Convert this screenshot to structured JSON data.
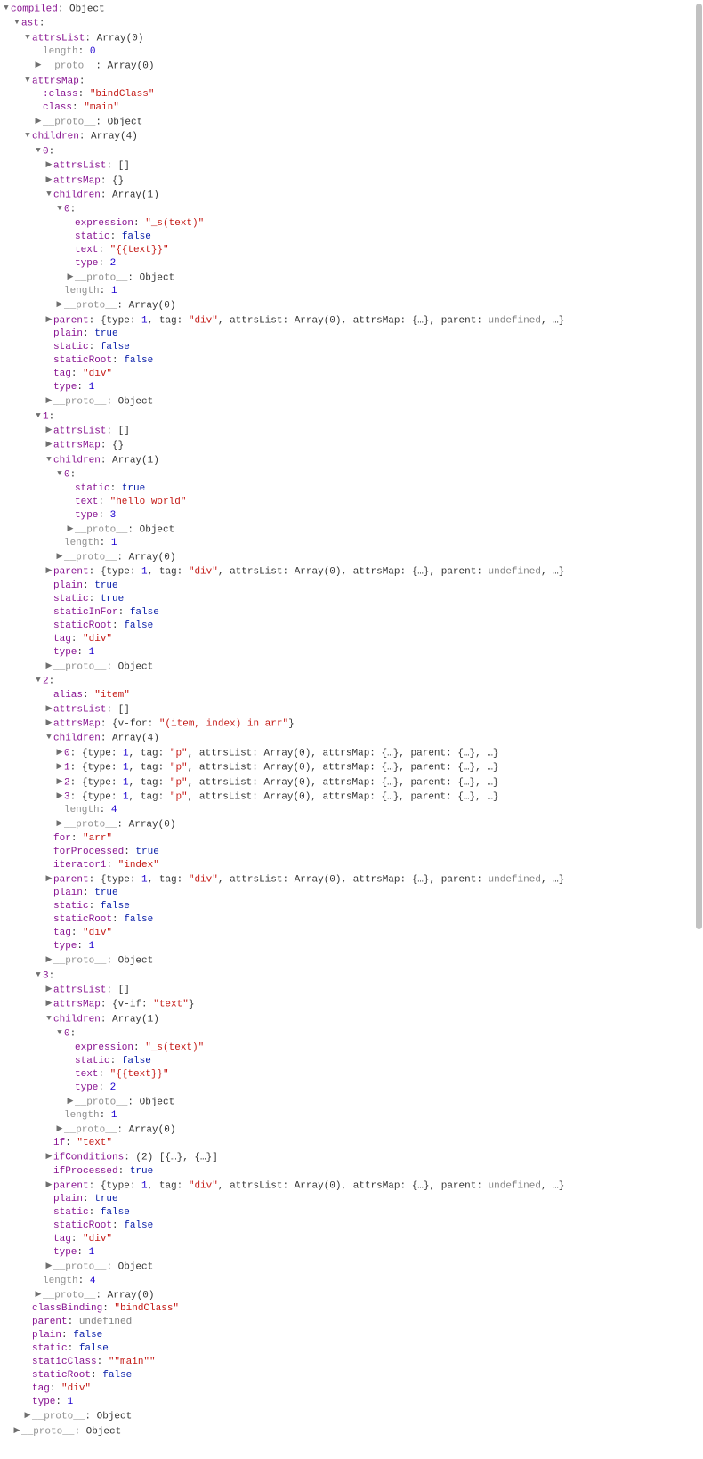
{
  "lines": [
    {
      "indent": 0,
      "arrow": "down",
      "key": "compiled",
      "cls": "key",
      "sep": ": ",
      "val": "Object",
      "vcls": "obj"
    },
    {
      "indent": 1,
      "arrow": "down",
      "key": "ast",
      "cls": "key",
      "sep": ":",
      "val": "",
      "vcls": ""
    },
    {
      "indent": 2,
      "arrow": "down",
      "key": "attrsList",
      "cls": "key",
      "sep": ": ",
      "val": "Array(0)",
      "vcls": "obj"
    },
    {
      "indent": 3,
      "arrow": "none",
      "key": "length",
      "cls": "faded",
      "sep": ": ",
      "val": "0",
      "vcls": "num"
    },
    {
      "indent": 3,
      "arrow": "right",
      "key": "__proto__",
      "cls": "faded",
      "sep": ": ",
      "val": "Array(0)",
      "vcls": "obj"
    },
    {
      "indent": 2,
      "arrow": "down",
      "key": "attrsMap",
      "cls": "key",
      "sep": ":",
      "val": "",
      "vcls": ""
    },
    {
      "indent": 3,
      "arrow": "none",
      "key": ":class",
      "cls": "key",
      "sep": ": ",
      "val": "\"bindClass\"",
      "vcls": "str"
    },
    {
      "indent": 3,
      "arrow": "none",
      "key": "class",
      "cls": "key",
      "sep": ": ",
      "val": "\"main\"",
      "vcls": "str"
    },
    {
      "indent": 3,
      "arrow": "right",
      "key": "__proto__",
      "cls": "faded",
      "sep": ": ",
      "val": "Object",
      "vcls": "obj"
    },
    {
      "indent": 2,
      "arrow": "down",
      "key": "children",
      "cls": "key",
      "sep": ": ",
      "val": "Array(4)",
      "vcls": "obj"
    },
    {
      "indent": 3,
      "arrow": "down",
      "key": "0",
      "cls": "key",
      "sep": ":",
      "val": "",
      "vcls": ""
    },
    {
      "indent": 4,
      "arrow": "right",
      "key": "attrsList",
      "cls": "key",
      "sep": ": ",
      "val": "[]",
      "vcls": "obj"
    },
    {
      "indent": 4,
      "arrow": "right",
      "key": "attrsMap",
      "cls": "key",
      "sep": ": ",
      "val": "{}",
      "vcls": "obj"
    },
    {
      "indent": 4,
      "arrow": "down",
      "key": "children",
      "cls": "key",
      "sep": ": ",
      "val": "Array(1)",
      "vcls": "obj"
    },
    {
      "indent": 5,
      "arrow": "down",
      "key": "0",
      "cls": "key",
      "sep": ":",
      "val": "",
      "vcls": ""
    },
    {
      "indent": 6,
      "arrow": "none",
      "key": "expression",
      "cls": "key",
      "sep": ": ",
      "val": "\"_s(text)\"",
      "vcls": "str"
    },
    {
      "indent": 6,
      "arrow": "none",
      "key": "static",
      "cls": "key",
      "sep": ": ",
      "val": "false",
      "vcls": "bool"
    },
    {
      "indent": 6,
      "arrow": "none",
      "key": "text",
      "cls": "key",
      "sep": ": ",
      "val": "\"{{text}}\"",
      "vcls": "str"
    },
    {
      "indent": 6,
      "arrow": "none",
      "key": "type",
      "cls": "key",
      "sep": ": ",
      "val": "2",
      "vcls": "num"
    },
    {
      "indent": 6,
      "arrow": "right",
      "key": "__proto__",
      "cls": "faded",
      "sep": ": ",
      "val": "Object",
      "vcls": "obj"
    },
    {
      "indent": 5,
      "arrow": "none",
      "key": "length",
      "cls": "faded",
      "sep": ": ",
      "val": "1",
      "vcls": "num"
    },
    {
      "indent": 5,
      "arrow": "right",
      "key": "__proto__",
      "cls": "faded",
      "sep": ": ",
      "val": "Array(0)",
      "vcls": "obj"
    },
    {
      "indent": 4,
      "arrow": "right",
      "key": "parent",
      "cls": "key",
      "sep": ": ",
      "html": "{type: <span class='num'>1</span>, tag: <span class='str'>\"div\"</span>, attrsList: Array(0), attrsMap: {…}, parent: <span class='undef'>undefined</span>, …}"
    },
    {
      "indent": 4,
      "arrow": "none",
      "key": "plain",
      "cls": "key",
      "sep": ": ",
      "val": "true",
      "vcls": "bool"
    },
    {
      "indent": 4,
      "arrow": "none",
      "key": "static",
      "cls": "key",
      "sep": ": ",
      "val": "false",
      "vcls": "bool"
    },
    {
      "indent": 4,
      "arrow": "none",
      "key": "staticRoot",
      "cls": "key",
      "sep": ": ",
      "val": "false",
      "vcls": "bool"
    },
    {
      "indent": 4,
      "arrow": "none",
      "key": "tag",
      "cls": "key",
      "sep": ": ",
      "val": "\"div\"",
      "vcls": "str"
    },
    {
      "indent": 4,
      "arrow": "none",
      "key": "type",
      "cls": "key",
      "sep": ": ",
      "val": "1",
      "vcls": "num"
    },
    {
      "indent": 4,
      "arrow": "right",
      "key": "__proto__",
      "cls": "faded",
      "sep": ": ",
      "val": "Object",
      "vcls": "obj"
    },
    {
      "indent": 3,
      "arrow": "down",
      "key": "1",
      "cls": "key",
      "sep": ":",
      "val": "",
      "vcls": ""
    },
    {
      "indent": 4,
      "arrow": "right",
      "key": "attrsList",
      "cls": "key",
      "sep": ": ",
      "val": "[]",
      "vcls": "obj"
    },
    {
      "indent": 4,
      "arrow": "right",
      "key": "attrsMap",
      "cls": "key",
      "sep": ": ",
      "val": "{}",
      "vcls": "obj"
    },
    {
      "indent": 4,
      "arrow": "down",
      "key": "children",
      "cls": "key",
      "sep": ": ",
      "val": "Array(1)",
      "vcls": "obj"
    },
    {
      "indent": 5,
      "arrow": "down",
      "key": "0",
      "cls": "key",
      "sep": ":",
      "val": "",
      "vcls": ""
    },
    {
      "indent": 6,
      "arrow": "none",
      "key": "static",
      "cls": "key",
      "sep": ": ",
      "val": "true",
      "vcls": "bool"
    },
    {
      "indent": 6,
      "arrow": "none",
      "key": "text",
      "cls": "key",
      "sep": ": ",
      "val": "\"hello world\"",
      "vcls": "str"
    },
    {
      "indent": 6,
      "arrow": "none",
      "key": "type",
      "cls": "key",
      "sep": ": ",
      "val": "3",
      "vcls": "num"
    },
    {
      "indent": 6,
      "arrow": "right",
      "key": "__proto__",
      "cls": "faded",
      "sep": ": ",
      "val": "Object",
      "vcls": "obj"
    },
    {
      "indent": 5,
      "arrow": "none",
      "key": "length",
      "cls": "faded",
      "sep": ": ",
      "val": "1",
      "vcls": "num"
    },
    {
      "indent": 5,
      "arrow": "right",
      "key": "__proto__",
      "cls": "faded",
      "sep": ": ",
      "val": "Array(0)",
      "vcls": "obj"
    },
    {
      "indent": 4,
      "arrow": "right",
      "key": "parent",
      "cls": "key",
      "sep": ": ",
      "html": "{type: <span class='num'>1</span>, tag: <span class='str'>\"div\"</span>, attrsList: Array(0), attrsMap: {…}, parent: <span class='undef'>undefined</span>, …}"
    },
    {
      "indent": 4,
      "arrow": "none",
      "key": "plain",
      "cls": "key",
      "sep": ": ",
      "val": "true",
      "vcls": "bool"
    },
    {
      "indent": 4,
      "arrow": "none",
      "key": "static",
      "cls": "key",
      "sep": ": ",
      "val": "true",
      "vcls": "bool"
    },
    {
      "indent": 4,
      "arrow": "none",
      "key": "staticInFor",
      "cls": "key",
      "sep": ": ",
      "val": "false",
      "vcls": "bool"
    },
    {
      "indent": 4,
      "arrow": "none",
      "key": "staticRoot",
      "cls": "key",
      "sep": ": ",
      "val": "false",
      "vcls": "bool"
    },
    {
      "indent": 4,
      "arrow": "none",
      "key": "tag",
      "cls": "key",
      "sep": ": ",
      "val": "\"div\"",
      "vcls": "str"
    },
    {
      "indent": 4,
      "arrow": "none",
      "key": "type",
      "cls": "key",
      "sep": ": ",
      "val": "1",
      "vcls": "num"
    },
    {
      "indent": 4,
      "arrow": "right",
      "key": "__proto__",
      "cls": "faded",
      "sep": ": ",
      "val": "Object",
      "vcls": "obj"
    },
    {
      "indent": 3,
      "arrow": "down",
      "key": "2",
      "cls": "key",
      "sep": ":",
      "val": "",
      "vcls": ""
    },
    {
      "indent": 4,
      "arrow": "none",
      "key": "alias",
      "cls": "key",
      "sep": ": ",
      "val": "\"item\"",
      "vcls": "str"
    },
    {
      "indent": 4,
      "arrow": "right",
      "key": "attrsList",
      "cls": "key",
      "sep": ": ",
      "val": "[]",
      "vcls": "obj"
    },
    {
      "indent": 4,
      "arrow": "right",
      "key": "attrsMap",
      "cls": "key",
      "sep": ": ",
      "html": "{v-for: <span class='str'>\"(item, index) in arr\"</span>}"
    },
    {
      "indent": 4,
      "arrow": "down",
      "key": "children",
      "cls": "key",
      "sep": ": ",
      "val": "Array(4)",
      "vcls": "obj"
    },
    {
      "indent": 5,
      "arrow": "right",
      "key": "0",
      "cls": "key",
      "sep": ": ",
      "html": "{type: <span class='num'>1</span>, tag: <span class='str'>\"p\"</span>, attrsList: Array(0), attrsMap: {…}, parent: {…}, …}"
    },
    {
      "indent": 5,
      "arrow": "right",
      "key": "1",
      "cls": "key",
      "sep": ": ",
      "html": "{type: <span class='num'>1</span>, tag: <span class='str'>\"p\"</span>, attrsList: Array(0), attrsMap: {…}, parent: {…}, …}"
    },
    {
      "indent": 5,
      "arrow": "right",
      "key": "2",
      "cls": "key",
      "sep": ": ",
      "html": "{type: <span class='num'>1</span>, tag: <span class='str'>\"p\"</span>, attrsList: Array(0), attrsMap: {…}, parent: {…}, …}"
    },
    {
      "indent": 5,
      "arrow": "right",
      "key": "3",
      "cls": "key",
      "sep": ": ",
      "html": "{type: <span class='num'>1</span>, tag: <span class='str'>\"p\"</span>, attrsList: Array(0), attrsMap: {…}, parent: {…}, …}"
    },
    {
      "indent": 5,
      "arrow": "none",
      "key": "length",
      "cls": "faded",
      "sep": ": ",
      "val": "4",
      "vcls": "num"
    },
    {
      "indent": 5,
      "arrow": "right",
      "key": "__proto__",
      "cls": "faded",
      "sep": ": ",
      "val": "Array(0)",
      "vcls": "obj"
    },
    {
      "indent": 4,
      "arrow": "none",
      "key": "for",
      "cls": "key",
      "sep": ": ",
      "val": "\"arr\"",
      "vcls": "str"
    },
    {
      "indent": 4,
      "arrow": "none",
      "key": "forProcessed",
      "cls": "key",
      "sep": ": ",
      "val": "true",
      "vcls": "bool"
    },
    {
      "indent": 4,
      "arrow": "none",
      "key": "iterator1",
      "cls": "key",
      "sep": ": ",
      "val": "\"index\"",
      "vcls": "str"
    },
    {
      "indent": 4,
      "arrow": "right",
      "key": "parent",
      "cls": "key",
      "sep": ": ",
      "html": "{type: <span class='num'>1</span>, tag: <span class='str'>\"div\"</span>, attrsList: Array(0), attrsMap: {…}, parent: <span class='undef'>undefined</span>, …}"
    },
    {
      "indent": 4,
      "arrow": "none",
      "key": "plain",
      "cls": "key",
      "sep": ": ",
      "val": "true",
      "vcls": "bool"
    },
    {
      "indent": 4,
      "arrow": "none",
      "key": "static",
      "cls": "key",
      "sep": ": ",
      "val": "false",
      "vcls": "bool"
    },
    {
      "indent": 4,
      "arrow": "none",
      "key": "staticRoot",
      "cls": "key",
      "sep": ": ",
      "val": "false",
      "vcls": "bool"
    },
    {
      "indent": 4,
      "arrow": "none",
      "key": "tag",
      "cls": "key",
      "sep": ": ",
      "val": "\"div\"",
      "vcls": "str"
    },
    {
      "indent": 4,
      "arrow": "none",
      "key": "type",
      "cls": "key",
      "sep": ": ",
      "val": "1",
      "vcls": "num"
    },
    {
      "indent": 4,
      "arrow": "right",
      "key": "__proto__",
      "cls": "faded",
      "sep": ": ",
      "val": "Object",
      "vcls": "obj"
    },
    {
      "indent": 3,
      "arrow": "down",
      "key": "3",
      "cls": "key",
      "sep": ":",
      "val": "",
      "vcls": ""
    },
    {
      "indent": 4,
      "arrow": "right",
      "key": "attrsList",
      "cls": "key",
      "sep": ": ",
      "val": "[]",
      "vcls": "obj"
    },
    {
      "indent": 4,
      "arrow": "right",
      "key": "attrsMap",
      "cls": "key",
      "sep": ": ",
      "html": "{v-if: <span class='str'>\"text\"</span>}"
    },
    {
      "indent": 4,
      "arrow": "down",
      "key": "children",
      "cls": "key",
      "sep": ": ",
      "val": "Array(1)",
      "vcls": "obj"
    },
    {
      "indent": 5,
      "arrow": "down",
      "key": "0",
      "cls": "key",
      "sep": ":",
      "val": "",
      "vcls": ""
    },
    {
      "indent": 6,
      "arrow": "none",
      "key": "expression",
      "cls": "key",
      "sep": ": ",
      "val": "\"_s(text)\"",
      "vcls": "str"
    },
    {
      "indent": 6,
      "arrow": "none",
      "key": "static",
      "cls": "key",
      "sep": ": ",
      "val": "false",
      "vcls": "bool"
    },
    {
      "indent": 6,
      "arrow": "none",
      "key": "text",
      "cls": "key",
      "sep": ": ",
      "val": "\"{{text}}\"",
      "vcls": "str"
    },
    {
      "indent": 6,
      "arrow": "none",
      "key": "type",
      "cls": "key",
      "sep": ": ",
      "val": "2",
      "vcls": "num"
    },
    {
      "indent": 6,
      "arrow": "right",
      "key": "__proto__",
      "cls": "faded",
      "sep": ": ",
      "val": "Object",
      "vcls": "obj"
    },
    {
      "indent": 5,
      "arrow": "none",
      "key": "length",
      "cls": "faded",
      "sep": ": ",
      "val": "1",
      "vcls": "num"
    },
    {
      "indent": 5,
      "arrow": "right",
      "key": "__proto__",
      "cls": "faded",
      "sep": ": ",
      "val": "Array(0)",
      "vcls": "obj"
    },
    {
      "indent": 4,
      "arrow": "none",
      "key": "if",
      "cls": "key",
      "sep": ": ",
      "val": "\"text\"",
      "vcls": "str"
    },
    {
      "indent": 4,
      "arrow": "right",
      "key": "ifConditions",
      "cls": "key",
      "sep": ": ",
      "html": "(2) [{…}, {…}]"
    },
    {
      "indent": 4,
      "arrow": "none",
      "key": "ifProcessed",
      "cls": "key",
      "sep": ": ",
      "val": "true",
      "vcls": "bool"
    },
    {
      "indent": 4,
      "arrow": "right",
      "key": "parent",
      "cls": "key",
      "sep": ": ",
      "html": "{type: <span class='num'>1</span>, tag: <span class='str'>\"div\"</span>, attrsList: Array(0), attrsMap: {…}, parent: <span class='undef'>undefined</span>, …}"
    },
    {
      "indent": 4,
      "arrow": "none",
      "key": "plain",
      "cls": "key",
      "sep": ": ",
      "val": "true",
      "vcls": "bool"
    },
    {
      "indent": 4,
      "arrow": "none",
      "key": "static",
      "cls": "key",
      "sep": ": ",
      "val": "false",
      "vcls": "bool"
    },
    {
      "indent": 4,
      "arrow": "none",
      "key": "staticRoot",
      "cls": "key",
      "sep": ": ",
      "val": "false",
      "vcls": "bool"
    },
    {
      "indent": 4,
      "arrow": "none",
      "key": "tag",
      "cls": "key",
      "sep": ": ",
      "val": "\"div\"",
      "vcls": "str"
    },
    {
      "indent": 4,
      "arrow": "none",
      "key": "type",
      "cls": "key",
      "sep": ": ",
      "val": "1",
      "vcls": "num"
    },
    {
      "indent": 4,
      "arrow": "right",
      "key": "__proto__",
      "cls": "faded",
      "sep": ": ",
      "val": "Object",
      "vcls": "obj"
    },
    {
      "indent": 3,
      "arrow": "none",
      "key": "length",
      "cls": "faded",
      "sep": ": ",
      "val": "4",
      "vcls": "num"
    },
    {
      "indent": 3,
      "arrow": "right",
      "key": "__proto__",
      "cls": "faded",
      "sep": ": ",
      "val": "Array(0)",
      "vcls": "obj"
    },
    {
      "indent": 2,
      "arrow": "none",
      "key": "classBinding",
      "cls": "key",
      "sep": ": ",
      "val": "\"bindClass\"",
      "vcls": "str"
    },
    {
      "indent": 2,
      "arrow": "none",
      "key": "parent",
      "cls": "key",
      "sep": ": ",
      "val": "undefined",
      "vcls": "undef"
    },
    {
      "indent": 2,
      "arrow": "none",
      "key": "plain",
      "cls": "key",
      "sep": ": ",
      "val": "false",
      "vcls": "bool"
    },
    {
      "indent": 2,
      "arrow": "none",
      "key": "static",
      "cls": "key",
      "sep": ": ",
      "val": "false",
      "vcls": "bool"
    },
    {
      "indent": 2,
      "arrow": "none",
      "key": "staticClass",
      "cls": "key",
      "sep": ": ",
      "val": "\"\"main\"\"",
      "vcls": "str"
    },
    {
      "indent": 2,
      "arrow": "none",
      "key": "staticRoot",
      "cls": "key",
      "sep": ": ",
      "val": "false",
      "vcls": "bool"
    },
    {
      "indent": 2,
      "arrow": "none",
      "key": "tag",
      "cls": "key",
      "sep": ": ",
      "val": "\"div\"",
      "vcls": "str"
    },
    {
      "indent": 2,
      "arrow": "none",
      "key": "type",
      "cls": "key",
      "sep": ": ",
      "val": "1",
      "vcls": "num"
    },
    {
      "indent": 2,
      "arrow": "right",
      "key": "__proto__",
      "cls": "faded",
      "sep": ": ",
      "val": "Object",
      "vcls": "obj"
    },
    {
      "indent": 1,
      "arrow": "right",
      "key": "__proto__",
      "cls": "faded",
      "sep": ": ",
      "val": "Object",
      "vcls": "obj"
    }
  ]
}
